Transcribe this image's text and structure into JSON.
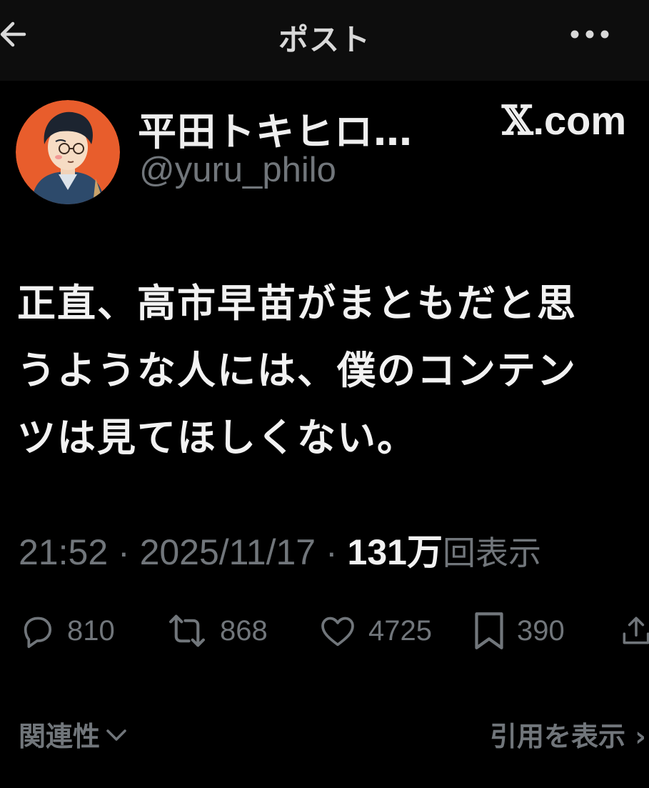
{
  "header": {
    "title": "ポスト",
    "back_icon": "arrow-left-icon",
    "more_icon": "more-horizontal-icon"
  },
  "author": {
    "display_name": "平田トキヒロ…",
    "handle": "@yuru_philo"
  },
  "site_label": {
    "logo": "𝕏",
    "text": ".com"
  },
  "post": {
    "lines": [
      "正直、高市早苗がまともだと思",
      "うような人には、僕のコンテン",
      "ツは見てほしくない。"
    ]
  },
  "meta": {
    "time": "21:52",
    "separator": " · ",
    "date": "2025/11/17",
    "views_count": "131万",
    "views_suffix": "回表示"
  },
  "actions": [
    {
      "icon": "reply-icon",
      "count": "810"
    },
    {
      "icon": "repost-icon",
      "count": "868"
    },
    {
      "icon": "like-icon",
      "count": "4725"
    },
    {
      "icon": "bookmark-icon",
      "count": "390"
    },
    {
      "icon": "share-icon",
      "count": ""
    }
  ],
  "footer": {
    "relevance_label": "関連性",
    "view_quotes_label": "引用を表示 ›"
  },
  "colors": {
    "background": "#000000",
    "header_bg": "#0d0d0d",
    "text": "#e7e9ea",
    "muted": "#71767b"
  }
}
